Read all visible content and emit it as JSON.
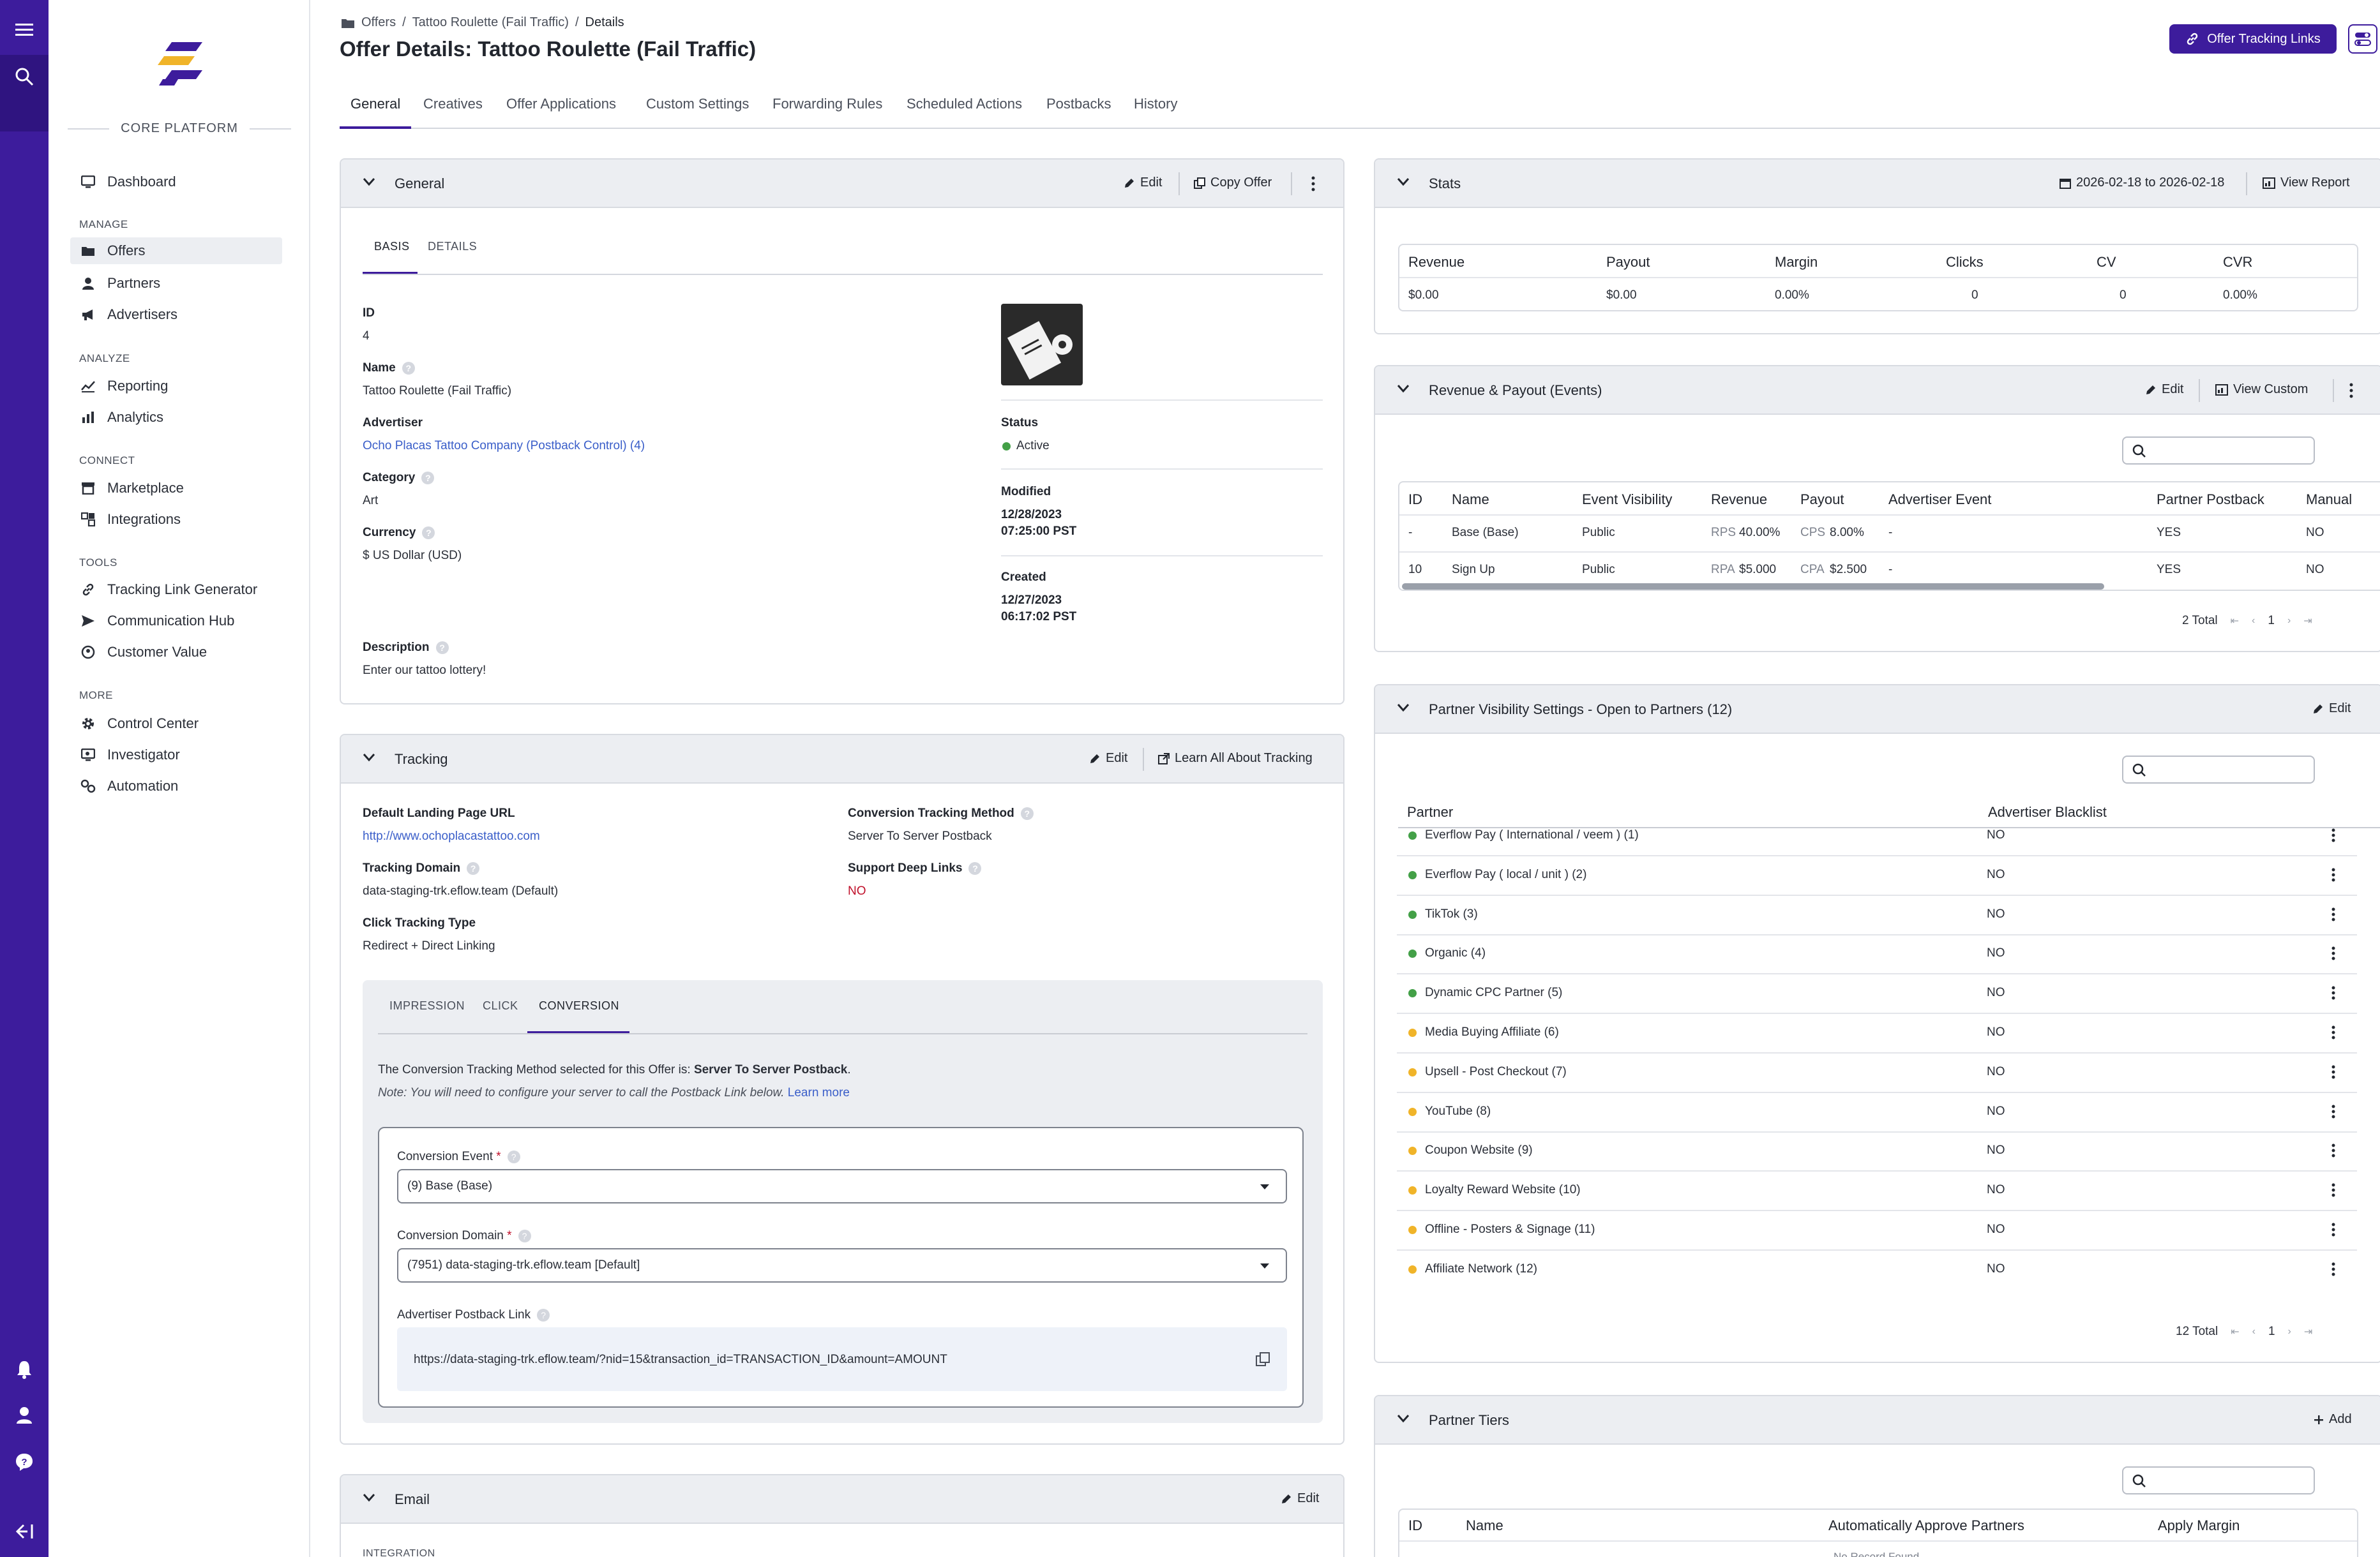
{
  "rail": {
    "icons": [
      "menu-icon",
      "search-icon",
      "bell-icon",
      "user-icon",
      "help-icon",
      "collapse-icon"
    ]
  },
  "sidebar": {
    "platform_label": "CORE PLATFORM",
    "sections": {
      "manage": "MANAGE",
      "analyze": "ANALYZE",
      "connect": "CONNECT",
      "tools": "TOOLS",
      "more": "MORE"
    },
    "items": {
      "dashboard": "Dashboard",
      "offers": "Offers",
      "partners": "Partners",
      "advertisers": "Advertisers",
      "reporting": "Reporting",
      "analytics": "Analytics",
      "marketplace": "Marketplace",
      "integrations": "Integrations",
      "tracking_link_generator": "Tracking Link Generator",
      "communication_hub": "Communication Hub",
      "customer_value": "Customer Value",
      "control_center": "Control Center",
      "investigator": "Investigator",
      "automation": "Automation"
    }
  },
  "breadcrumb": {
    "offers": "Offers",
    "sep1": "/",
    "offer": "Tattoo Roulette (Fail Traffic)",
    "sep2": "/",
    "current": "Details"
  },
  "page_title": "Offer Details: Tattoo Roulette (Fail Traffic)",
  "header_button": "Offer Tracking Links",
  "tabs": {
    "general": "General",
    "creatives": "Creatives",
    "offer_applications": "Offer Applications",
    "custom_settings": "Custom Settings",
    "forwarding_rules": "Forwarding Rules",
    "scheduled_actions": "Scheduled Actions",
    "postbacks": "Postbacks",
    "history": "History"
  },
  "general_panel": {
    "title": "General",
    "edit": "Edit",
    "copy": "Copy Offer",
    "subtabs": {
      "basis": "BASIS",
      "details": "DETAILS"
    },
    "id_label": "ID",
    "id_value": "4",
    "name_label": "Name",
    "name_value": "Tattoo Roulette (Fail Traffic)",
    "advertiser_label": "Advertiser",
    "advertiser_value": "Ocho Placas Tattoo Company (Postback Control) (4)",
    "category_label": "Category",
    "category_value": "Art",
    "currency_label": "Currency",
    "currency_value": "$ US Dollar (USD)",
    "description_label": "Description",
    "description_value": "Enter our tattoo lottery!",
    "status_label": "Status",
    "status_value": "Active",
    "modified_label": "Modified",
    "modified_date": "12/28/2023",
    "modified_time": "07:25:00 PST",
    "created_label": "Created",
    "created_date": "12/27/2023",
    "created_time": "06:17:02 PST"
  },
  "tracking_panel": {
    "title": "Tracking",
    "edit": "Edit",
    "learn": "Learn All About Tracking",
    "landing_label": "Default Landing Page URL",
    "landing_value": "http://www.ochoplacastattoo.com",
    "domain_label": "Tracking Domain",
    "domain_value": "data-staging-trk.eflow.team (Default)",
    "click_type_label": "Click Tracking Type",
    "click_type_value": "Redirect + Direct Linking",
    "conv_method_label": "Conversion Tracking Method",
    "conv_method_value": "Server To Server Postback",
    "deep_links_label": "Support Deep Links",
    "deep_links_value": "NO",
    "subtabs": {
      "impression": "IMPRESSION",
      "click": "CLICK",
      "conversion": "CONVERSION"
    },
    "info_text": "The Conversion Tracking Method selected for this Offer is: ",
    "info_bold": "Server To Server Postback",
    "info_end": ".",
    "note_text": "Note: You will need to configure your server to call the Postback Link below.",
    "learn_more": "Learn more",
    "conv_event_label": "Conversion Event",
    "conv_event_value": "(9) Base (Base)",
    "conv_domain_label": "Conversion Domain",
    "conv_domain_value": "(7951) data-staging-trk.eflow.team [Default]",
    "required_mark": "*",
    "postback_label": "Advertiser Postback Link",
    "postback_value": "https://data-staging-trk.eflow.team/?nid=15&transaction_id=TRANSACTION_ID&amount=AMOUNT"
  },
  "email_panel": {
    "title": "Email",
    "edit": "Edit",
    "integration": "INTEGRATION"
  },
  "stats_panel": {
    "title": "Stats",
    "date_range": "2026-02-18 to 2026-02-18",
    "view_report": "View Report",
    "headers": [
      "Revenue",
      "Payout",
      "Margin",
      "Clicks",
      "CV",
      "CVR"
    ],
    "values": [
      "$0.00",
      "$0.00",
      "0.00%",
      "0",
      "0",
      "0.00%"
    ]
  },
  "revpay_panel": {
    "title": "Revenue & Payout (Events)",
    "edit": "Edit",
    "view_custom": "View Custom",
    "headers": [
      "ID",
      "Name",
      "Event Visibility",
      "Revenue",
      "Payout",
      "Advertiser Event",
      "Partner Postback",
      "Manual"
    ],
    "rows": [
      {
        "id": "-",
        "name": "Base (Base)",
        "visibility": "Public",
        "rev_type": "RPS",
        "rev": "40.00%",
        "pay_type": "CPS",
        "pay": "8.00%",
        "adv_event": "-",
        "postback": "YES",
        "manual": "NO"
      },
      {
        "id": "10",
        "name": "Sign Up",
        "visibility": "Public",
        "rev_type": "RPA",
        "rev": "$5.000",
        "pay_type": "CPA",
        "pay": "$2.500",
        "adv_event": "-",
        "postback": "YES",
        "manual": "NO"
      }
    ],
    "total": "2 Total",
    "page": "1"
  },
  "visibility_panel": {
    "title": "Partner Visibility Settings - Open to Partners (12)",
    "edit": "Edit",
    "headers": [
      "Partner",
      "Advertiser Blacklist"
    ],
    "rows": [
      {
        "name": "Everflow Pay ( International / veem ) (1)",
        "status": "green",
        "blacklist": "NO"
      },
      {
        "name": "Everflow Pay ( local / unit ) (2)",
        "status": "green",
        "blacklist": "NO"
      },
      {
        "name": "TikTok (3)",
        "status": "green",
        "blacklist": "NO"
      },
      {
        "name": "Organic (4)",
        "status": "green",
        "blacklist": "NO"
      },
      {
        "name": "Dynamic CPC Partner (5)",
        "status": "green",
        "blacklist": "NO"
      },
      {
        "name": "Media Buying Affiliate (6)",
        "status": "yellow",
        "blacklist": "NO"
      },
      {
        "name": "Upsell - Post Checkout (7)",
        "status": "yellow",
        "blacklist": "NO"
      },
      {
        "name": "YouTube (8)",
        "status": "yellow",
        "blacklist": "NO"
      },
      {
        "name": "Coupon Website (9)",
        "status": "yellow",
        "blacklist": "NO"
      },
      {
        "name": "Loyalty Reward Website (10)",
        "status": "yellow",
        "blacklist": "NO"
      },
      {
        "name": "Offline - Posters & Signage (11)",
        "status": "yellow",
        "blacklist": "NO"
      },
      {
        "name": "Affiliate Network (12)",
        "status": "yellow",
        "blacklist": "NO"
      }
    ],
    "total": "12 Total",
    "page": "1"
  },
  "tiers_panel": {
    "title": "Partner Tiers",
    "add": "Add",
    "headers": [
      "ID",
      "Name",
      "Automatically Approve Partners",
      "Apply Margin"
    ],
    "empty": "No Record Found"
  },
  "colors": {
    "brand": "#3d1c9c",
    "link": "#3a5ec9",
    "no": "#c0102a",
    "yes": "#2e7d32",
    "dot_green": "#43a047",
    "dot_yellow": "#f0b429"
  }
}
